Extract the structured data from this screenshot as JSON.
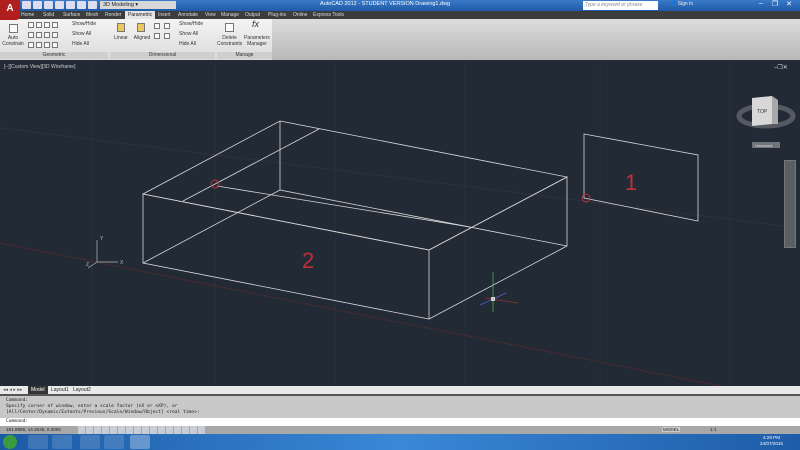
{
  "titlebar": {
    "workspace": "3D Modeling",
    "title": "AutoCAD 2012 - STUDENT VERSION   Drawing1.dwg",
    "search_placeholder": "Type a keyword or phrase",
    "signin": "Sign In"
  },
  "tabs": [
    "Home",
    "Solid",
    "Surface",
    "Mesh",
    "Render",
    "Parametric",
    "Insert",
    "Annotate",
    "View",
    "Manage",
    "Output",
    "Plug-ins",
    "Online",
    "Express Tools"
  ],
  "active_tab": "Parametric",
  "ribbon": {
    "geometric": {
      "label": "Geometric",
      "auto_constrain": "Auto Constrain",
      "show_hide": "Show/Hide",
      "show_all": "Show All",
      "hide_all": "Hide All"
    },
    "dimensional": {
      "label": "Dimensional",
      "linear": "Linear",
      "aligned": "Aligned",
      "show_hide": "Show/Hide",
      "show_all": "Show All",
      "hide_all": "Hide All"
    },
    "manage": {
      "label": "Manage",
      "delete_constraints": "Delete Constraints",
      "parameters_manager": "Parameters Manager"
    }
  },
  "viewport": {
    "label": "[−][Custom View][3D Wireframe]",
    "viewcube_face": "TOP",
    "viewcube_menu": "Unnamed",
    "ucs_x": "X",
    "ucs_y": "Y",
    "ucs_z": "Z",
    "annotations": [
      "1",
      "2",
      "0"
    ]
  },
  "layout_tabs": [
    "Model",
    "Layout1",
    "Layout2"
  ],
  "command": {
    "history": [
      "Command:",
      "Specify corner of window, enter a scale factor (nX or nXP), or",
      "[All/Center/Dynamic/Extents/Previous/Scale/Window/Object] <real time>:"
    ],
    "prompt": "Command:"
  },
  "status": {
    "coords": "161.8956, 14.2046, 0.0000",
    "model": "MODEL",
    "scale": "1:1"
  },
  "clock": {
    "time": "4:28 PM",
    "date": "24/07/2015"
  },
  "colors": {
    "background": "#222a35",
    "wire": "#d8d8d8",
    "red_annot": "#c03038",
    "accent": "#b01e1e"
  }
}
